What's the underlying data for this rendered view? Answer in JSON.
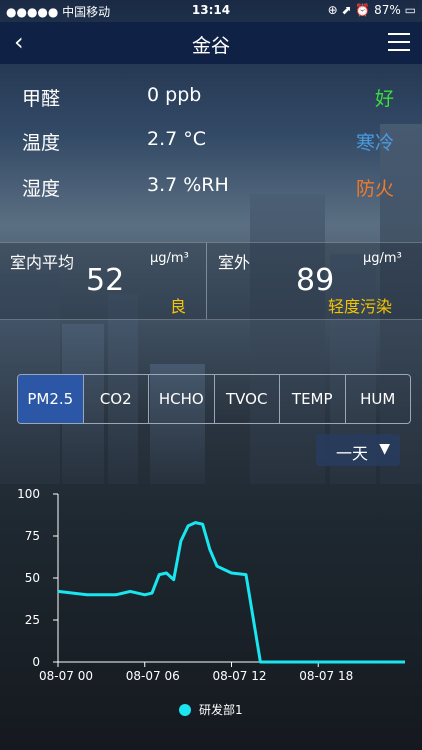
{
  "status_bar": {
    "carrier": "●●●●● 中国移动",
    "time": "13:14",
    "battery": "⊕ ⬈ ⏰ 87% ▭"
  },
  "nav": {
    "title": "金谷",
    "back_icon": "chevron-left-icon",
    "menu_icon": "hamburger-menu-icon"
  },
  "readings": [
    {
      "label": "甲醛",
      "value": "0 ppb",
      "status": "好",
      "status_color": "#3ddc3d"
    },
    {
      "label": "温度",
      "value": "2.7 °C",
      "status": "寒冷",
      "status_color": "#4a9be0"
    },
    {
      "label": "湿度",
      "value": "3.7 %RH",
      "status": "防火",
      "status_color": "#f07a2a"
    }
  ],
  "compare": {
    "indoor": {
      "label": "室内平均",
      "unit": "μg/m³",
      "value": "52",
      "status": "良"
    },
    "outdoor": {
      "label": "室外",
      "unit": "μg/m³",
      "value": "89",
      "status": "轻度污染"
    }
  },
  "tabs": [
    {
      "label": "PM2.5",
      "active": true
    },
    {
      "label": "CO2",
      "active": false
    },
    {
      "label": "HCHO",
      "active": false
    },
    {
      "label": "TVOC",
      "active": false
    },
    {
      "label": "TEMP",
      "active": false
    },
    {
      "label": "HUM",
      "active": false
    }
  ],
  "range_select": {
    "label": "一天",
    "icon": "dropdown-triangle-icon"
  },
  "chart_data": {
    "type": "line",
    "y_ticks": [
      "100",
      "75",
      "50",
      "25",
      "0"
    ],
    "ylim": [
      0,
      100
    ],
    "x_ticks": [
      "08-07 00",
      "08-07 06",
      "08-07 12",
      "08-07 18"
    ],
    "xlim": [
      0,
      24
    ],
    "series": [
      {
        "name": "研发部1",
        "color": "#19e6f0",
        "x": [
          0,
          2,
          3,
          4,
          5,
          6,
          6.5,
          7,
          7.5,
          8,
          8.5,
          9,
          9.5,
          10,
          10.5,
          11,
          11.5,
          12,
          13,
          14,
          24
        ],
        "y": [
          42,
          40,
          40,
          40,
          42,
          40,
          41,
          52,
          53,
          49,
          72,
          81,
          83,
          82,
          67,
          57,
          55,
          53,
          52,
          0,
          0
        ]
      }
    ]
  }
}
